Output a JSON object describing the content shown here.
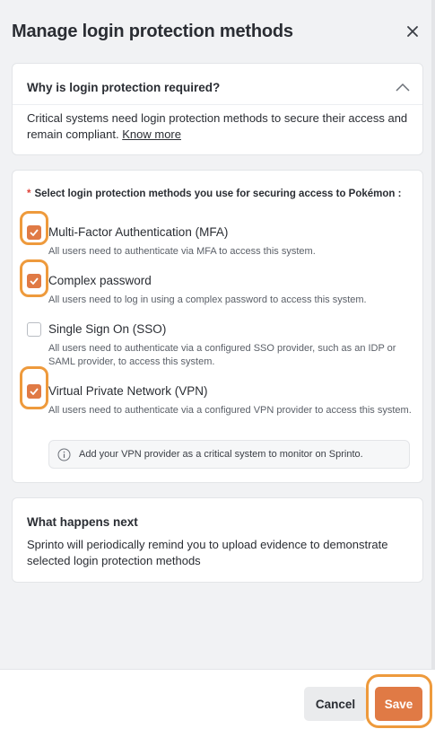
{
  "dialog": {
    "title": "Manage login protection methods",
    "close_icon": "close-icon"
  },
  "why_section": {
    "heading": "Why is login protection required?",
    "body": "Critical systems need login protection methods to secure their access and remain compliant.",
    "link": "Know more",
    "toggle_icon": "chevron-up-icon"
  },
  "methods_section": {
    "required_marker": "*",
    "prompt": "Select login protection methods you use for securing access to Pokémon :",
    "options": [
      {
        "label": "Multi-Factor Authentication (MFA)",
        "checked": true,
        "description": "All users need to authenticate via MFA to access this system."
      },
      {
        "label": "Complex password",
        "checked": true,
        "description": "All users need to log in using a complex password to access this system."
      },
      {
        "label": "Single Sign On (SSO)",
        "checked": false,
        "description": "All users need to authenticate via a configured SSO provider, such as an IDP or SAML provider, to access this system."
      },
      {
        "label": "Virtual Private Network (VPN)",
        "checked": true,
        "description": "All users need to authenticate via a configured VPN provider to access this system."
      }
    ],
    "info_icon": "info-icon",
    "info_text": "Add your VPN provider as a critical system to monitor on Sprinto."
  },
  "next_section": {
    "heading": "What happens next",
    "body": "Sprinto will periodically remind you to upload evidence to demonstrate selected login protection methods"
  },
  "footer": {
    "cancel_label": "Cancel",
    "save_label": "Save"
  },
  "colors": {
    "accent": "#e07a45",
    "highlight_ring": "#ee9a3c"
  }
}
